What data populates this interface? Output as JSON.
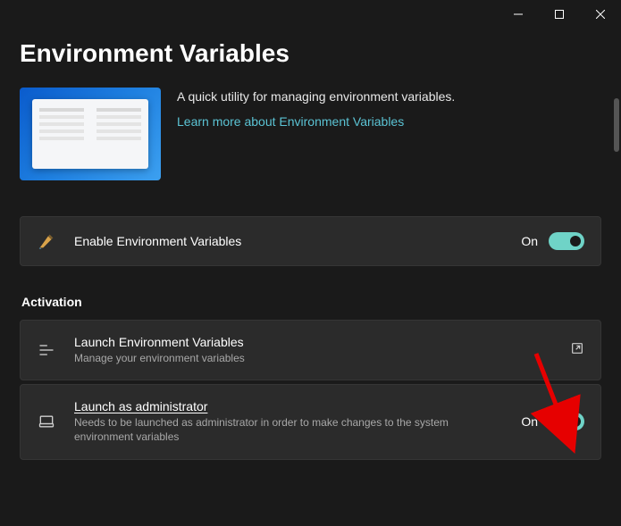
{
  "window": {
    "title": "Environment Variables"
  },
  "hero": {
    "description": "A quick utility for managing environment variables.",
    "link_text": "Learn more about Environment Variables"
  },
  "enable_card": {
    "title": "Enable Environment Variables",
    "state": "On"
  },
  "section_activation": "Activation",
  "launch_card": {
    "title": "Launch Environment Variables",
    "subtitle": "Manage your environment variables"
  },
  "admin_card": {
    "title": "Launch as administrator",
    "subtitle": "Needs to be launched as administrator in order to make changes to the system environment variables",
    "state": "On"
  }
}
